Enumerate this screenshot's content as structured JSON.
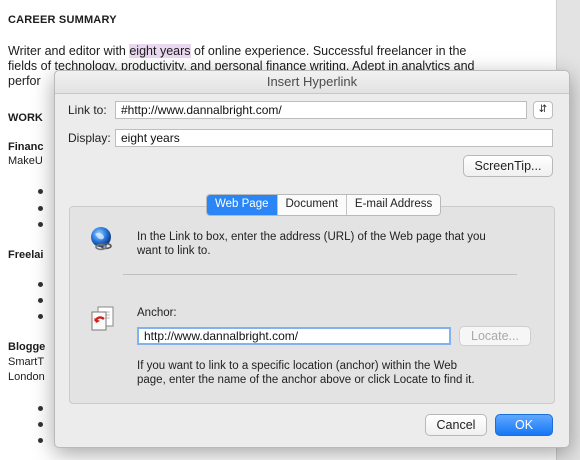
{
  "document": {
    "heading": "CAREER SUMMARY",
    "para_before": "Writer and editor with ",
    "para_highlight": "eight years",
    "para_after": " of online experience. Successful freelancer in the",
    "line2": "fields of technology, productivity, and personal finance writing. Adept in analytics and",
    "line3": "perfor",
    "work": "WORK",
    "fin1": "Financ",
    "fin2": "MakeU",
    "free": "Freelai",
    "blog": "Blogge",
    "smart": "SmartT",
    "london": "London"
  },
  "dialog": {
    "title": "Insert Hyperlink",
    "link_to_label": "Link to:",
    "link_to_value": "#http://www.dannalbright.com/",
    "display_label": "Display:",
    "display_value": "eight years",
    "screentip": "ScreenTip...",
    "tabs": [
      "Web Page",
      "Document",
      "E-mail Address"
    ],
    "web_text": "In the Link to box, enter the address (URL) of the Web page that you want to link to.",
    "web_line1": "In the Link to box, enter the address (URL) of the Web page that you",
    "web_line2": "want to link to.",
    "anchor_label": "Anchor:",
    "anchor_value": "http://www.dannalbright.com/",
    "locate": "Locate...",
    "help_line1": "If you want to link to a specific location (anchor) within the Web",
    "help_line2": "page, enter the name of the anchor above or click Locate to find it.",
    "cancel": "Cancel",
    "ok": "OK"
  },
  "colors": {
    "accent": "#2a86f6",
    "highlight": "#ead7f0"
  }
}
